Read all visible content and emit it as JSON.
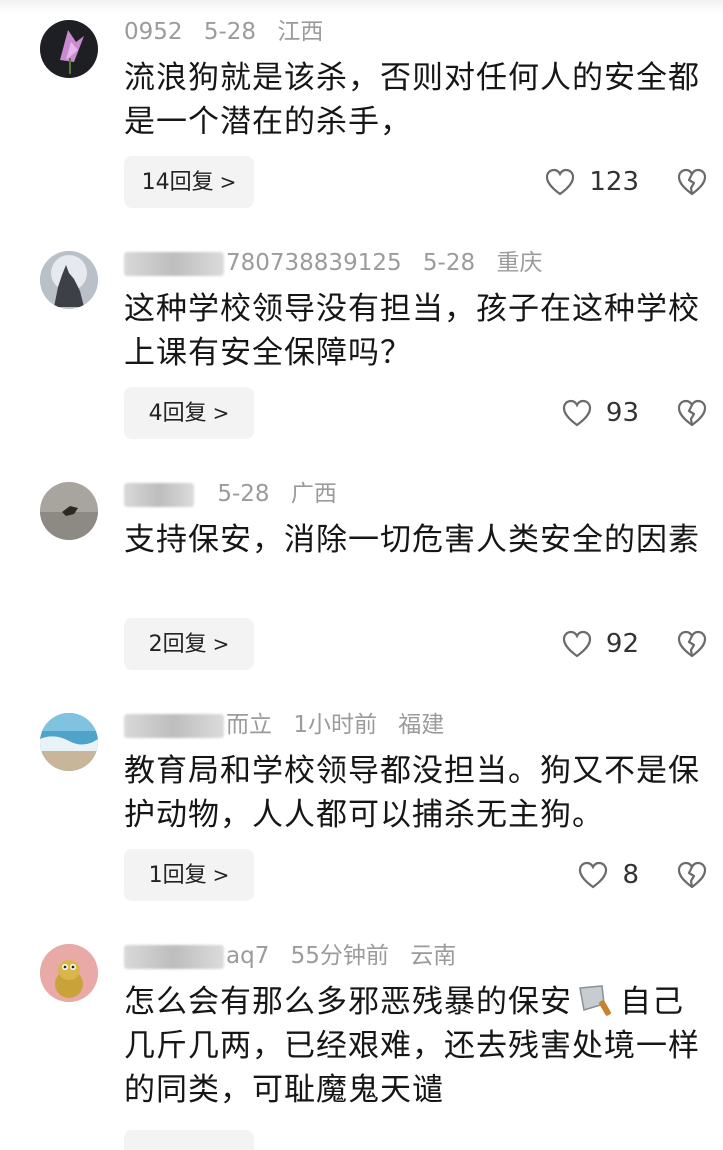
{
  "comments": [
    {
      "name": "0952",
      "date": "5-28",
      "region": "江西",
      "text": "流浪狗就是该杀，否则对任何人的安全都是一个潜在的杀手，",
      "reply": "14回复",
      "likes": "123"
    },
    {
      "name": "780738839125",
      "date": "5-28",
      "region": "重庆",
      "text": "这种学校领导没有担当，孩子在这种学校上课有安全保障吗？",
      "reply": "4回复",
      "likes": "93"
    },
    {
      "name": "",
      "date": "5-28",
      "region": "广西",
      "text": "支持保安，消除一切危害人类安全的因素",
      "reply": "2回复",
      "likes": "92"
    },
    {
      "name": "而立",
      "date": "1小时前",
      "region": "福建",
      "text": "教育局和学校领导都没担当。狗又不是保护动物，人人都可以捕杀无主狗。",
      "reply": "1回复",
      "likes": "8"
    },
    {
      "name": "aq7",
      "date": "55分钟前",
      "region": "云南",
      "text_part1": "怎么会有那么多邪恶残暴的保安",
      "text_part2": "自己几斤几两，已经艰难，还去残害处境一样的同类，可耻魔鬼天谴"
    }
  ],
  "colors": {
    "meta_gray": "#9b9b9b",
    "reply_bg": "#f3f3f3",
    "text": "#161616"
  },
  "icons": {
    "like": "heart-outline-icon",
    "dislike": "broken-heart-icon",
    "reply_chevron": "chevron-right-icon",
    "emoji": "cleaver-knife-icon"
  }
}
